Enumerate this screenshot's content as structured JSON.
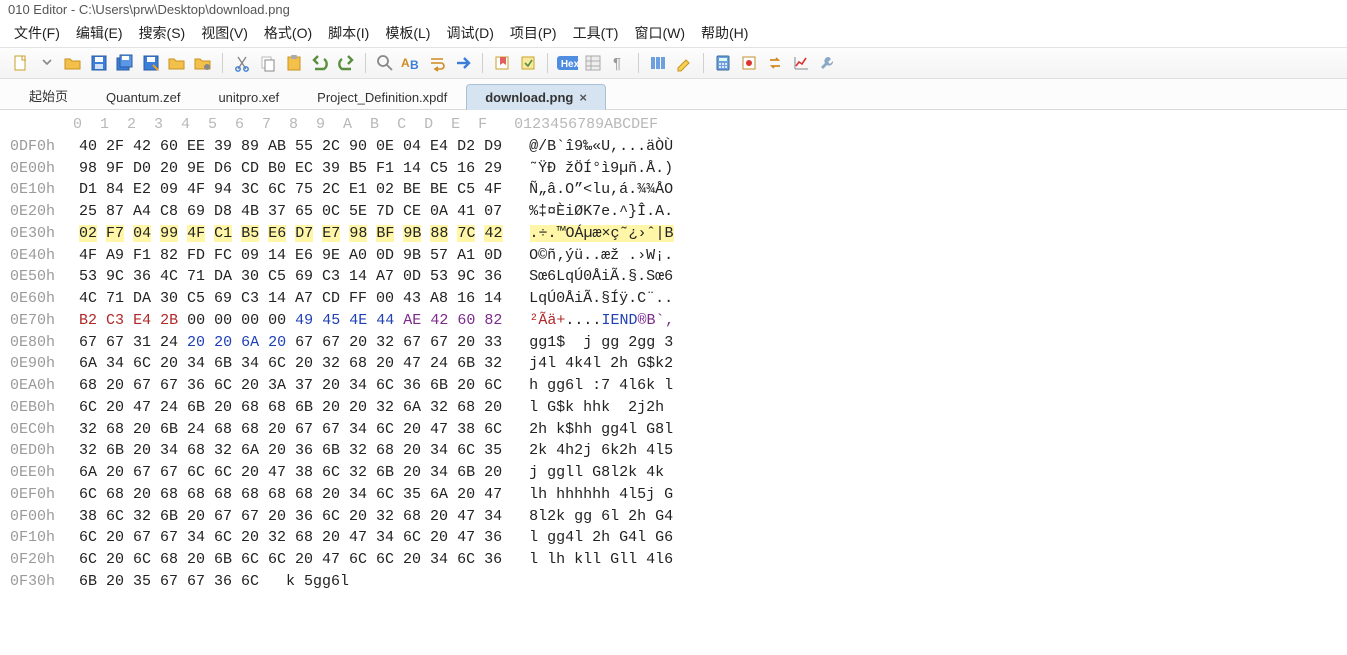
{
  "title": "010 Editor - C:\\Users\\prw\\Desktop\\download.png",
  "menu": {
    "file": "文件(F)",
    "edit": "编辑(E)",
    "search": "搜索(S)",
    "view": "视图(V)",
    "format": "格式(O)",
    "script": "脚本(I)",
    "template": "模板(L)",
    "debug": "调试(D)",
    "project": "项目(P)",
    "tools": "工具(T)",
    "window": "窗口(W)",
    "help": "帮助(H)"
  },
  "toolbarIcons": [
    "new",
    "chevron",
    "open",
    "save",
    "saveall",
    "saveas",
    "folder",
    "foldergear",
    "sep",
    "cut",
    "copy",
    "paste",
    "undo",
    "redo",
    "sep",
    "find",
    "findreplace",
    "wrap",
    "goto",
    "sep",
    "bookmark",
    "bookmarknav",
    "sep",
    "hex",
    "struct",
    "para",
    "sep",
    "columns",
    "highlight",
    "sep",
    "calc",
    "record",
    "swap",
    "chart",
    "tools"
  ],
  "iconLabel": {
    "hex": "Hex"
  },
  "tabs": [
    {
      "label": "起始页",
      "active": false,
      "closable": false
    },
    {
      "label": "Quantum.zef",
      "active": false,
      "closable": false
    },
    {
      "label": "unitpro.xef",
      "active": false,
      "closable": false
    },
    {
      "label": "Project_Definition.xpdf",
      "active": false,
      "closable": false
    },
    {
      "label": "download.png",
      "active": true,
      "closable": true
    }
  ],
  "hex": {
    "colHeader": "       0  1  2  3  4  5  6  7  8  9  A  B  C  D  E  F   0123456789ABCDEF",
    "rows": [
      {
        "ofs": "0DF0h",
        "b": [
          "40",
          "2F",
          "42",
          "60",
          "EE",
          "39",
          "89",
          "AB",
          "55",
          "2C",
          "90",
          "0E",
          "04",
          "E4",
          "D2",
          "D9"
        ],
        "a": "@/B`î9‰«U,...äÒÙ"
      },
      {
        "ofs": "0E00h",
        "b": [
          "98",
          "9F",
          "D0",
          "20",
          "9E",
          "D6",
          "CD",
          "B0",
          "EC",
          "39",
          "B5",
          "F1",
          "14",
          "C5",
          "16",
          "29"
        ],
        "a": "˜ŸÐ žÖÍ°ì9µñ.Å.)"
      },
      {
        "ofs": "0E10h",
        "b": [
          "D1",
          "84",
          "E2",
          "09",
          "4F",
          "94",
          "3C",
          "6C",
          "75",
          "2C",
          "E1",
          "02",
          "BE",
          "BE",
          "C5",
          "4F"
        ],
        "a": "Ñ„â.O”<lu,á.¾¾ÅO"
      },
      {
        "ofs": "0E20h",
        "b": [
          "25",
          "87",
          "A4",
          "C8",
          "69",
          "D8",
          "4B",
          "37",
          "65",
          "0C",
          "5E",
          "7D",
          "CE",
          "0A",
          "41",
          "07"
        ],
        "a": "%‡¤ÈiØK7e.^}Î.A."
      },
      {
        "ofs": "0E30h",
        "b": [
          "02",
          "F7",
          "04",
          "99",
          "4F",
          "C1",
          "B5",
          "E6",
          "D7",
          "E7",
          "98",
          "BF",
          "9B",
          "88",
          "7C",
          "42"
        ],
        "a": ".÷.™OÁµæ×ç˜¿›ˆ|B",
        "hl": true
      },
      {
        "ofs": "0E40h",
        "b": [
          "4F",
          "A9",
          "F1",
          "82",
          "FD",
          "FC",
          "09",
          "14",
          "E6",
          "9E",
          "A0",
          "0D",
          "9B",
          "57",
          "A1",
          "0D"
        ],
        "a": "O©ñ‚ýü..æž .›W¡."
      },
      {
        "ofs": "0E50h",
        "b": [
          "53",
          "9C",
          "36",
          "4C",
          "71",
          "DA",
          "30",
          "C5",
          "69",
          "C3",
          "14",
          "A7",
          "0D",
          "53",
          "9C",
          "36"
        ],
        "a": "Sœ6LqÚ0ÅiÃ.§.Sœ6"
      },
      {
        "ofs": "0E60h",
        "b": [
          "4C",
          "71",
          "DA",
          "30",
          "C5",
          "69",
          "C3",
          "14",
          "A7",
          "CD",
          "FF",
          "00",
          "43",
          "A8",
          "16",
          "14"
        ],
        "a": "LqÚ0ÅiÃ.§Íÿ.C¨.."
      },
      {
        "ofs": "0E70h",
        "b": [
          "B2",
          "C3",
          "E4",
          "2B",
          "00",
          "00",
          "00",
          "00",
          "49",
          "45",
          "4E",
          "44",
          "AE",
          "42",
          "60",
          "82"
        ],
        "a": "²Ãä+....IEND®B`‚",
        "special": true
      },
      {
        "ofs": "0E80h",
        "b": [
          "67",
          "67",
          "31",
          "24",
          "20",
          "20",
          "6A",
          "20",
          "67",
          "67",
          "20",
          "32",
          "67",
          "67",
          "20",
          "33"
        ],
        "a": "gg1$  j gg 2gg 3",
        "ascentblue": true
      },
      {
        "ofs": "0E90h",
        "b": [
          "6A",
          "34",
          "6C",
          "20",
          "34",
          "6B",
          "34",
          "6C",
          "20",
          "32",
          "68",
          "20",
          "47",
          "24",
          "6B",
          "32"
        ],
        "a": "j4l 4k4l 2h G$k2"
      },
      {
        "ofs": "0EA0h",
        "b": [
          "68",
          "20",
          "67",
          "67",
          "36",
          "6C",
          "20",
          "3A",
          "37",
          "20",
          "34",
          "6C",
          "36",
          "6B",
          "20",
          "6C"
        ],
        "a": "h gg6l :7 4l6k l"
      },
      {
        "ofs": "0EB0h",
        "b": [
          "6C",
          "20",
          "47",
          "24",
          "6B",
          "20",
          "68",
          "68",
          "6B",
          "20",
          "20",
          "32",
          "6A",
          "32",
          "68",
          "20"
        ],
        "a": "l G$k hhk  2j2h "
      },
      {
        "ofs": "0EC0h",
        "b": [
          "32",
          "68",
          "20",
          "6B",
          "24",
          "68",
          "68",
          "20",
          "67",
          "67",
          "34",
          "6C",
          "20",
          "47",
          "38",
          "6C"
        ],
        "a": "2h k$hh gg4l G8l"
      },
      {
        "ofs": "0ED0h",
        "b": [
          "32",
          "6B",
          "20",
          "34",
          "68",
          "32",
          "6A",
          "20",
          "36",
          "6B",
          "32",
          "68",
          "20",
          "34",
          "6C",
          "35"
        ],
        "a": "2k 4h2j 6k2h 4l5"
      },
      {
        "ofs": "0EE0h",
        "b": [
          "6A",
          "20",
          "67",
          "67",
          "6C",
          "6C",
          "20",
          "47",
          "38",
          "6C",
          "32",
          "6B",
          "20",
          "34",
          "6B",
          "20"
        ],
        "a": "j ggll G8l2k 4k "
      },
      {
        "ofs": "0EF0h",
        "b": [
          "6C",
          "68",
          "20",
          "68",
          "68",
          "68",
          "68",
          "68",
          "68",
          "20",
          "34",
          "6C",
          "35",
          "6A",
          "20",
          "47"
        ],
        "a": "lh hhhhhh 4l5j G"
      },
      {
        "ofs": "0F00h",
        "b": [
          "38",
          "6C",
          "32",
          "6B",
          "20",
          "67",
          "67",
          "20",
          "36",
          "6C",
          "20",
          "32",
          "68",
          "20",
          "47",
          "34"
        ],
        "a": "8l2k gg 6l 2h G4"
      },
      {
        "ofs": "0F10h",
        "b": [
          "6C",
          "20",
          "67",
          "67",
          "34",
          "6C",
          "20",
          "32",
          "68",
          "20",
          "47",
          "34",
          "6C",
          "20",
          "47",
          "36"
        ],
        "a": "l gg4l 2h G4l G6"
      },
      {
        "ofs": "0F20h",
        "b": [
          "6C",
          "20",
          "6C",
          "68",
          "20",
          "6B",
          "6C",
          "6C",
          "20",
          "47",
          "6C",
          "6C",
          "20",
          "34",
          "6C",
          "36"
        ],
        "a": "l lh kll Gll 4l6"
      },
      {
        "ofs": "0F30h",
        "b": [
          "6B",
          "20",
          "35",
          "67",
          "67",
          "36",
          "6C"
        ],
        "a": "k 5gg6l"
      }
    ]
  }
}
